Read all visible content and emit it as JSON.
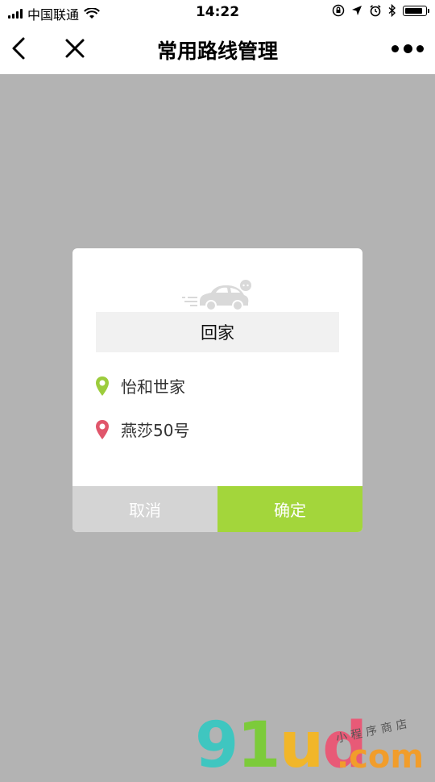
{
  "status_bar": {
    "carrier": "中国联通",
    "time": "14:22"
  },
  "nav": {
    "title": "常用路线管理"
  },
  "dialog": {
    "route_name": "回家",
    "start": "怡和世家",
    "end": "燕莎50号",
    "cancel_label": "取消",
    "confirm_label": "确定"
  },
  "colors": {
    "accent": "#a3d63b",
    "start_pin": "#9ccc3c",
    "end_pin": "#e0566b",
    "overlay": "#b3b3b3",
    "cancel_bg": "#d4d4d4"
  },
  "battery_level": 0.9,
  "watermark": {
    "brand": "91ud",
    "domain": ".com",
    "tagline": "小程序商店"
  }
}
